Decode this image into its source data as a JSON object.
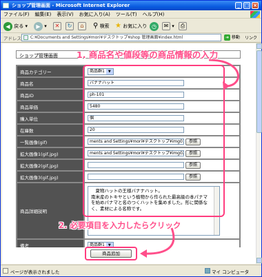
{
  "window": {
    "title": "ショップ管理画面 - Microsoft Internet Explorer"
  },
  "menu": [
    "ファイル(F)",
    "編集(E)",
    "表示(V)",
    "お気に入り(A)",
    "ツール(T)",
    "ヘルプ(H)"
  ],
  "toolbar": {
    "back": "戻る",
    "search": "検索",
    "favorites": "お気に入り"
  },
  "address": {
    "label": "アドレス(D)",
    "value": "C:¥Documents and Settings¥mori¥デスクトップ¥shop 管理画面¥index.html",
    "go": "移動",
    "links": "リンク"
  },
  "page": {
    "shop_title": "ショップ管理画面",
    "callout1": "1. 商品名や値段等の商品情報の入力",
    "callout2": "2. 必要項目を入力したらクリック",
    "fields": {
      "category_label": "商品カテゴリー",
      "category_value": "商品群1",
      "name_label": "商品名",
      "name_value": "バナナハット",
      "id_label": "商品ID",
      "id_value": "ph-101",
      "price_label": "商品単価",
      "price_value": "5480",
      "unit_label": "購入単位",
      "unit_value": "個",
      "stock_label": "在庫数",
      "stock_value": "20",
      "list_image_label": "一覧画像(gif)",
      "list_image_value": "ments and Settings¥mori¥デスクトップ¥img01.gif",
      "zoom1_label": "拡大画像1(gif,jpg)",
      "zoom1_value": "ments and Settings¥mori¥デスクトップ¥img02.jpg",
      "zoom2_label": "拡大画像2(gif,jpg)",
      "zoom3_label": "拡大画像3(gif,jpg)",
      "browse": "参照",
      "detail_label": "商品詳細説明",
      "detail_value": "　夏物ハットの王様バナナハット。\n南米産のトキヤという植物から作られた最高級の本パナマを始めパナマと名のつくハットを集めました。形に関係なく、素材による名称です。",
      "remark_label": "備考",
      "remark_value": "商品群1"
    },
    "add_button": "商品追加"
  },
  "status": {
    "text": "ページが表示されました",
    "zone": "マイ コンピュータ"
  },
  "colors": {
    "accent": "#ff4e8a",
    "label_bg": "#525252",
    "title_bar": "#0a5ce0"
  }
}
